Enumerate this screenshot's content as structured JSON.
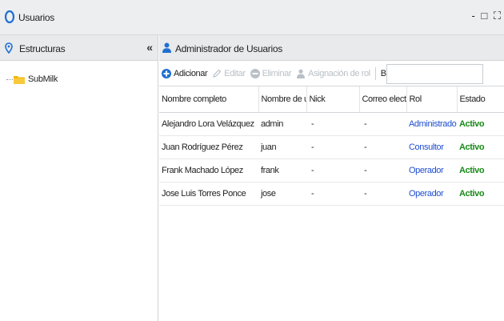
{
  "window": {
    "title": "Usuarios",
    "controls": [
      "-",
      "□",
      "⛶"
    ]
  },
  "left_panel": {
    "title": "Estructuras",
    "collapse_glyph": "«",
    "tree": [
      {
        "label": "SubMilk"
      }
    ]
  },
  "main_panel": {
    "title": "Administrador de Usuarios",
    "toolbar": {
      "add_label": "Adicionar",
      "edit_label": "Editar",
      "delete_label": "Eliminar",
      "assign_label": "Asignación de rol",
      "search_label": "Buscar:",
      "search_value": "",
      "search_placeholder": ""
    },
    "table": {
      "headers": [
        "Nombre completo",
        "Nombre de usuari",
        "Nick",
        "Correo electrónico",
        "Rol",
        "Estado"
      ],
      "rows": [
        [
          "Alejandro Lora Velázquez",
          "admin",
          "-",
          "-",
          "Administrador",
          "Activo"
        ],
        [
          "Juan Rodríguez Pérez",
          "juan",
          "-",
          "-",
          "Consultor",
          "Activo"
        ],
        [
          "Frank Machado López",
          "frank",
          "-",
          "-",
          "Operador",
          "Activo"
        ],
        [
          "Jose Luis Torres Ponce",
          "jose",
          "-",
          "-",
          "Operador",
          "Activo"
        ]
      ]
    }
  },
  "colors": {
    "accent": "#1f6fd1",
    "role_link": "#1f4fd1",
    "status_active": "#1a8a1a",
    "disabled": "#b9c0c7"
  },
  "icons": {
    "app": "user-badge-icon",
    "pin": "map-pin-icon",
    "folder": "folder-icon",
    "user": "user-icon",
    "add": "plus-circle-icon",
    "edit": "pencil-icon",
    "delete": "minus-circle-icon",
    "assign": "user-assign-icon"
  }
}
